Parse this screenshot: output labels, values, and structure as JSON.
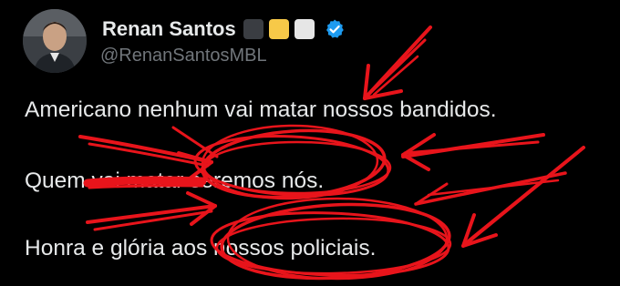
{
  "author": {
    "display_name": "Renan Santos",
    "handle": "@RenanSantosMBL",
    "flags": [
      "#3a3d42",
      "#f7c948",
      "#e6e6e6"
    ],
    "verified_color": "#1d9bf0"
  },
  "tweet": {
    "lines": [
      "Americano nenhum vai matar nossos bandidos.",
      "Quem vai matar seremos nós.",
      "Honra e glória aos nossos policiais."
    ]
  },
  "annotation": {
    "color": "#e8141b",
    "icon": "red-arrow-scribble-overlay"
  }
}
